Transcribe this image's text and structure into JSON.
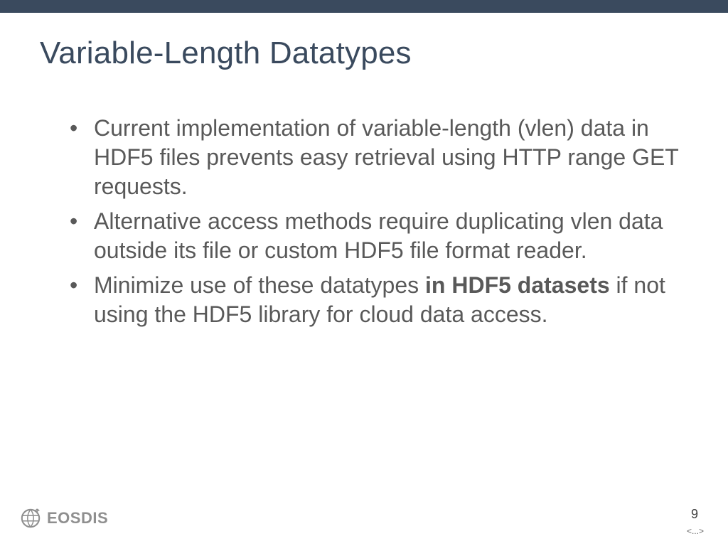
{
  "title": "Variable-Length Datatypes",
  "bullets": [
    {
      "parts": [
        {
          "text": "Current implementation of variable-length (vlen) data in HDF5 files prevents easy retrieval using HTTP range GET requests.",
          "bold": false
        }
      ]
    },
    {
      "parts": [
        {
          "text": "Alternative access methods require duplicating vlen data outside its file or custom HDF5 file format reader.",
          "bold": false
        }
      ]
    },
    {
      "parts": [
        {
          "text": "Minimize use of these datatypes ",
          "bold": false
        },
        {
          "text": "in HDF5 datasets",
          "bold": true
        },
        {
          "text": " if not using the HDF5 library for cloud data access.",
          "bold": false
        }
      ]
    }
  ],
  "footer": {
    "logo_text": "EOSDIS",
    "page_number": "9",
    "ellipsis": "<...>"
  }
}
